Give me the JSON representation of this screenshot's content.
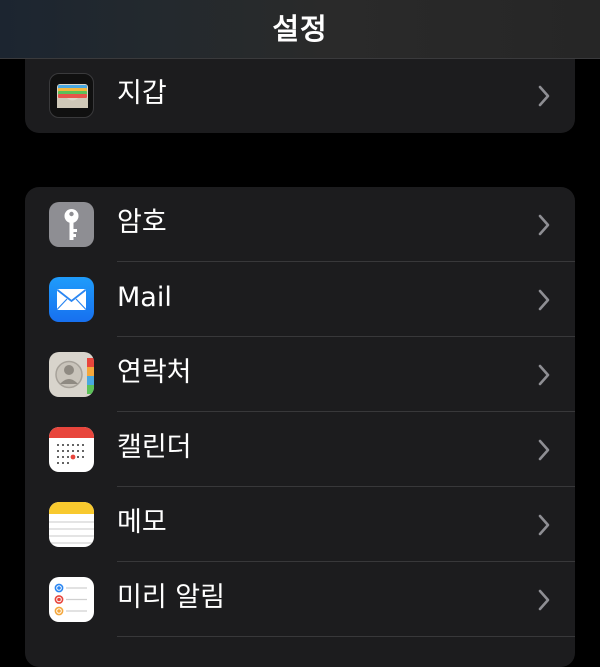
{
  "navbar": {
    "title": "설정"
  },
  "group1": {
    "items": [
      {
        "label": "지갑",
        "icon": "wallet-icon"
      }
    ]
  },
  "group2": {
    "items": [
      {
        "label": "암호",
        "icon": "key-icon"
      },
      {
        "label": "Mail",
        "icon": "mail-icon"
      },
      {
        "label": "연락처",
        "icon": "contacts-icon"
      },
      {
        "label": "캘린더",
        "icon": "calendar-icon"
      },
      {
        "label": "메모",
        "icon": "notes-icon"
      },
      {
        "label": "미리 알림",
        "icon": "reminders-icon"
      }
    ]
  },
  "colors": {
    "background": "#000000",
    "group_background": "#1c1c1e",
    "separator": "#38383a",
    "chevron": "#8e8e93",
    "mail_blue": "#1e8cf5",
    "calendar_red": "#e8453c"
  }
}
